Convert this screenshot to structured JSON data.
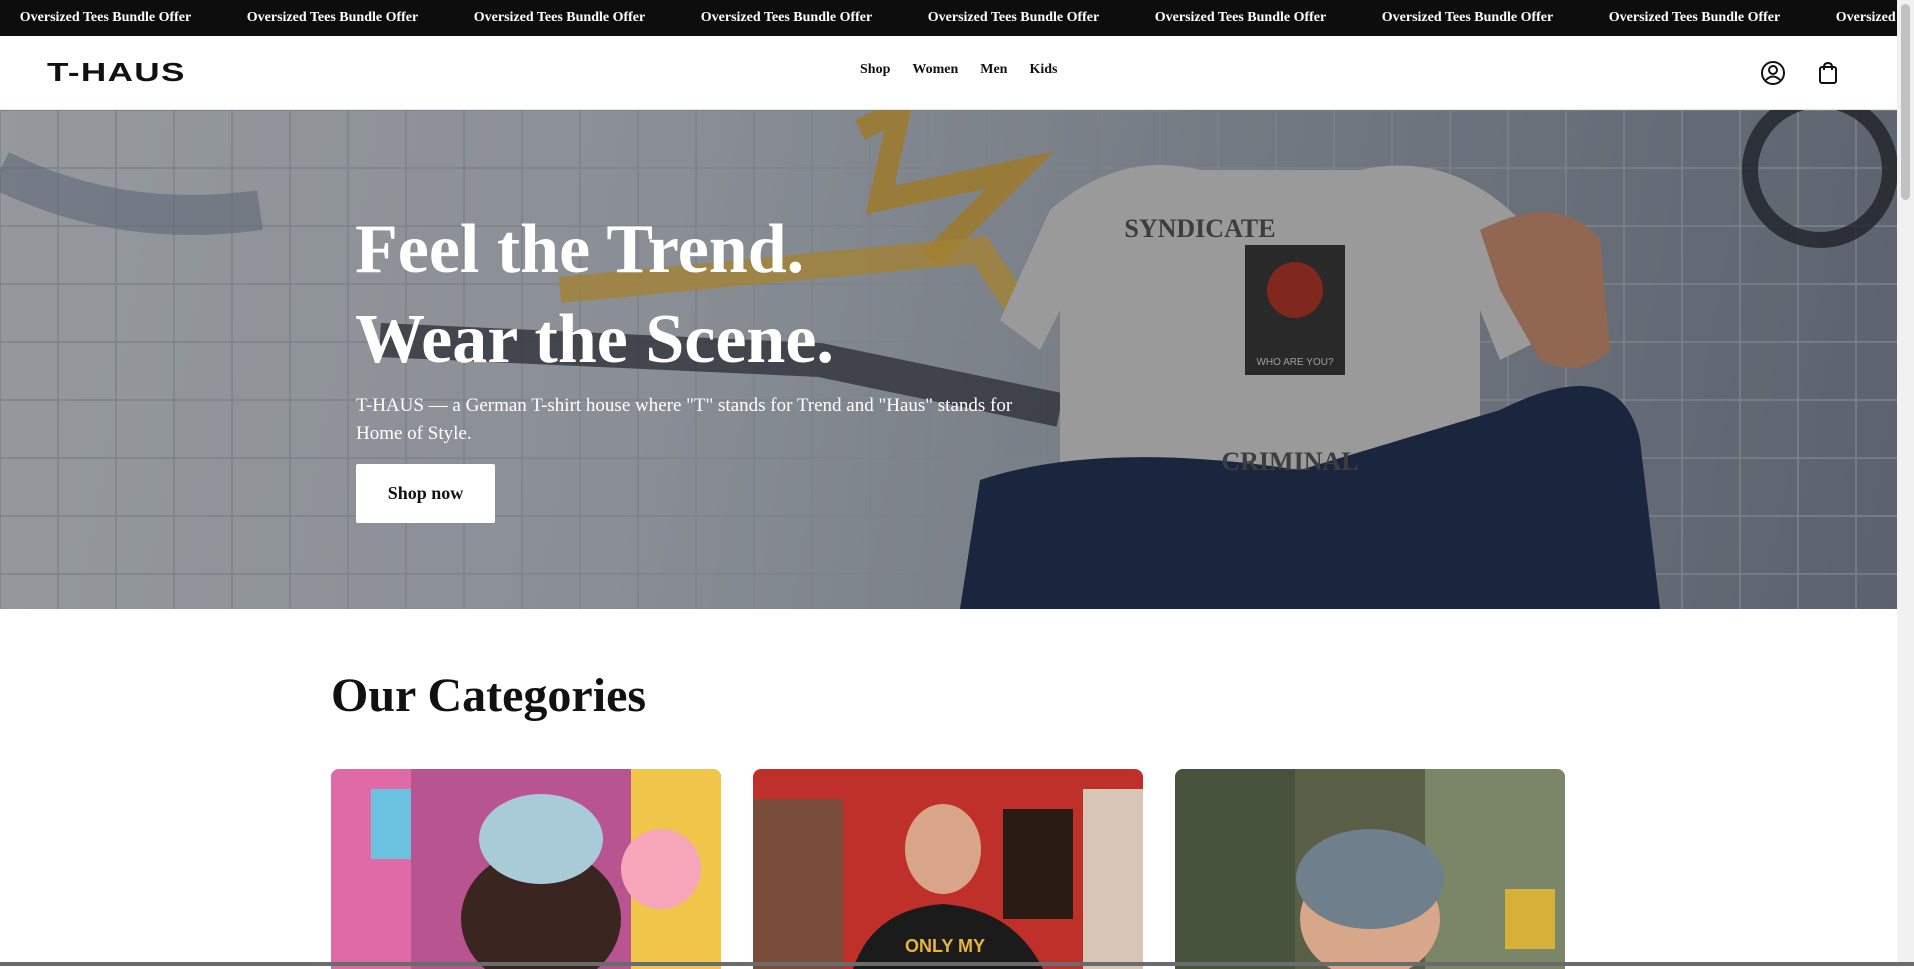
{
  "announcement": {
    "items": [
      "Oversized Tees Bundle Offer",
      "Oversized Tees Bundle Offer",
      "Oversized Tees Bundle Offer",
      "Oversized Tees Bundle Offer",
      "Oversized Tees Bundle Offer",
      "Oversized Tees Bundle Offer",
      "Oversized Tees Bundle Offer",
      "Oversized Tees Bundle Offer",
      "Oversized Tees Bundle Offer"
    ]
  },
  "header": {
    "logo": "T-HAUS",
    "nav": [
      "Shop",
      "Women",
      "Men",
      "Kids"
    ],
    "icons": [
      "account-icon",
      "cart-icon"
    ]
  },
  "hero": {
    "title_line1": "Feel the Trend.",
    "title_line2": "Wear the Scene.",
    "subtitle": "T-HAUS — a German T-shirt house where \"T\" stands for Trend and \"Haus\" stands for Home of Style.",
    "cta": "Shop now",
    "shirt_print_top": "SYNDICATE",
    "shirt_print_mid": "WHO ARE YOU?",
    "shirt_print_bottom": "CRIMINAL"
  },
  "categories": {
    "title": "Our Categories",
    "cards": [
      {
        "image": "men-category-photo"
      },
      {
        "image": "women-category-photo",
        "shirt_text": "ONLY MY"
      },
      {
        "image": "kids-category-photo"
      }
    ]
  },
  "colors": {
    "announcement_bg": "#0d0d0d",
    "text": "#111111",
    "button_bg": "#ffffff"
  }
}
